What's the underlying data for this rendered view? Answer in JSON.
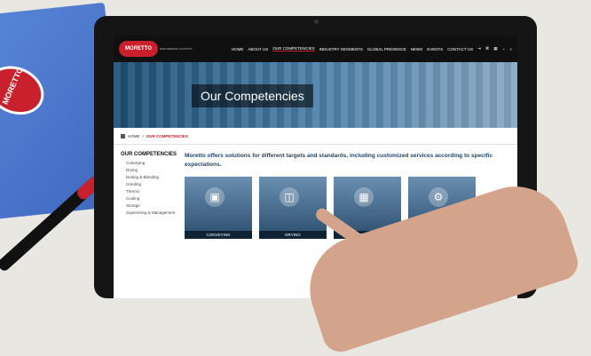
{
  "nav": {
    "logo": "MORETTO",
    "tagline": "EMPOWERING PLASTICS",
    "items": [
      "HOME",
      "ABOUT US",
      "OUR COMPETENCIES",
      "INDUSTRY SEGMENTS",
      "GLOBAL PRESENCE",
      "NEWS",
      "EVENTS",
      "CONTACT US"
    ]
  },
  "hero": {
    "title": "Our Competencies"
  },
  "breadcrumb": {
    "home": "HOME",
    "separator": "/",
    "current": "OUR COMPETENCIES"
  },
  "sidebar": {
    "title": "OUR COMPETENCIES",
    "items": [
      "Conveying",
      "Drying",
      "Dosing & Blending",
      "Grinding",
      "Thermo",
      "Cooling",
      "Storage",
      "Supervising & Management"
    ]
  },
  "main": {
    "intro": "Moretto offers solutions for different targets and standards, including customized services according to specific expectations.",
    "cards": [
      "CONVEYING",
      "DRYING",
      "DOSING & BLENDING",
      ""
    ]
  },
  "folder": {
    "logo": "MORETTO"
  },
  "colors": {
    "brand_red": "#c8202d",
    "nav_bg": "#101010",
    "intro_blue": "#24456a"
  }
}
